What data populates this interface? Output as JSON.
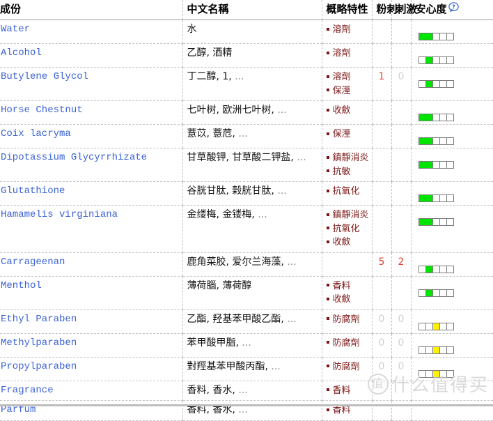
{
  "table": {
    "columns": [
      {
        "key": "name",
        "label": "成份"
      },
      {
        "key": "cn",
        "label": "中文名稱"
      },
      {
        "key": "feat",
        "label": "概略特性"
      },
      {
        "key": "acne",
        "label": "粉刺"
      },
      {
        "key": "irr",
        "label": "刺激"
      },
      {
        "key": "safe",
        "label": "安心度"
      }
    ],
    "help_icon": "question-mark-icon",
    "ellipsis": "...",
    "rows": [
      {
        "name": "Water",
        "cn": "水",
        "cn_more": "",
        "features": [
          "溶劑"
        ],
        "acne": "",
        "irritation": "",
        "safety_cells": [
          "green",
          "green",
          "empty",
          "empty",
          "empty"
        ]
      },
      {
        "name": "Alcohol",
        "cn": "乙醇, 酒精",
        "cn_more": "",
        "features": [
          "溶劑"
        ],
        "acne": "",
        "irritation": "",
        "safety_cells": [
          "empty",
          "green",
          "empty",
          "empty",
          "empty"
        ]
      },
      {
        "name": "Butylene Glycol",
        "cn": "丁二醇, 1,",
        "cn_more": "...",
        "features": [
          "溶劑",
          "保溼"
        ],
        "acne": "1",
        "irritation": "0",
        "safety_cells": [
          "empty",
          "green",
          "empty",
          "empty",
          "empty"
        ]
      },
      {
        "name": "Horse Chestnut",
        "cn": "七叶树, 欧洲七叶树,",
        "cn_more": "...",
        "features": [
          "收斂"
        ],
        "acne": "",
        "irritation": "",
        "safety_cells": [
          "green",
          "green",
          "empty",
          "empty",
          "empty"
        ]
      },
      {
        "name": "Coix lacryma",
        "cn": "薏苡, 薏苊,",
        "cn_more": "...",
        "features": [
          "保溼"
        ],
        "acne": "",
        "irritation": "",
        "safety_cells": [
          "green",
          "green",
          "empty",
          "empty",
          "empty"
        ]
      },
      {
        "name": "Dipotassium Glycyrrhizate",
        "cn": "甘草酸钾, 甘草酸二钾盐,",
        "cn_more": "...",
        "features": [
          "鎮靜消炎",
          "抗敏"
        ],
        "acne": "",
        "irritation": "",
        "safety_cells": [
          "green",
          "green",
          "empty",
          "empty",
          "empty"
        ]
      },
      {
        "name": "Glutathione",
        "cn": "谷胱甘肽, 榖胱甘肽,",
        "cn_more": "...",
        "features": [
          "抗氧化"
        ],
        "acne": "",
        "irritation": "",
        "safety_cells": [
          "green",
          "green",
          "empty",
          "empty",
          "empty"
        ]
      },
      {
        "name": "Hamamelis virginiana",
        "cn": "金缕梅, 金镂梅,",
        "cn_more": "...",
        "features": [
          "鎮靜消炎",
          "抗氧化",
          "收斂"
        ],
        "acne": "",
        "irritation": "",
        "safety_cells": [
          "green",
          "green",
          "empty",
          "empty",
          "empty"
        ]
      },
      {
        "name": "Carrageenan",
        "cn": "鹿角菜胶, 爱尔兰海藻,",
        "cn_more": "...",
        "features": [],
        "acne": "5",
        "irritation": "2",
        "safety_cells": [
          "empty",
          "green",
          "empty",
          "empty",
          "empty"
        ]
      },
      {
        "name": "Menthol",
        "cn": "薄荷腦, 薄荷醇",
        "cn_more": "",
        "features": [
          "香料",
          "收斂"
        ],
        "acne": "",
        "irritation": "",
        "safety_cells": [
          "empty",
          "green",
          "empty",
          "empty",
          "empty"
        ]
      },
      {
        "name": "Ethyl Paraben",
        "cn": "乙酯, 羟基苯甲酸乙酯,",
        "cn_more": "...",
        "features": [
          "防腐劑"
        ],
        "acne": "0",
        "irritation": "0",
        "safety_cells": [
          "empty",
          "empty",
          "yellow",
          "empty",
          "empty"
        ]
      },
      {
        "name": "Methylparaben",
        "cn": "苯甲酸甲脂,",
        "cn_more": "...",
        "features": [
          "防腐劑"
        ],
        "acne": "0",
        "irritation": "0",
        "safety_cells": [
          "empty",
          "empty",
          "yellow",
          "empty",
          "empty"
        ]
      },
      {
        "name": "Propylparaben",
        "cn": "對羥基苯甲酸丙酯,",
        "cn_more": "...",
        "features": [
          "防腐劑"
        ],
        "acne": "0",
        "irritation": "0",
        "safety_cells": [
          "empty",
          "empty",
          "yellow",
          "empty",
          "empty"
        ]
      },
      {
        "name": "Fragrance",
        "cn": "香料, 香水,",
        "cn_more": "...",
        "features": [
          "香料"
        ],
        "acne": "",
        "irritation": "",
        "safety_cells": []
      },
      {
        "name": "Parfum",
        "cn": "香料, 香水,",
        "cn_more": "...",
        "features": [
          "香料"
        ],
        "acne": "",
        "irritation": "",
        "safety_cells": []
      }
    ]
  },
  "watermark": {
    "badge": "值",
    "text": "什么值得买"
  },
  "colors": {
    "link": "#3b62d6",
    "feature": "#7a1414",
    "warn": "#e8402a",
    "zero": "#cfcfcf",
    "meter_green": "#00e500",
    "meter_yellow": "#fff200"
  }
}
